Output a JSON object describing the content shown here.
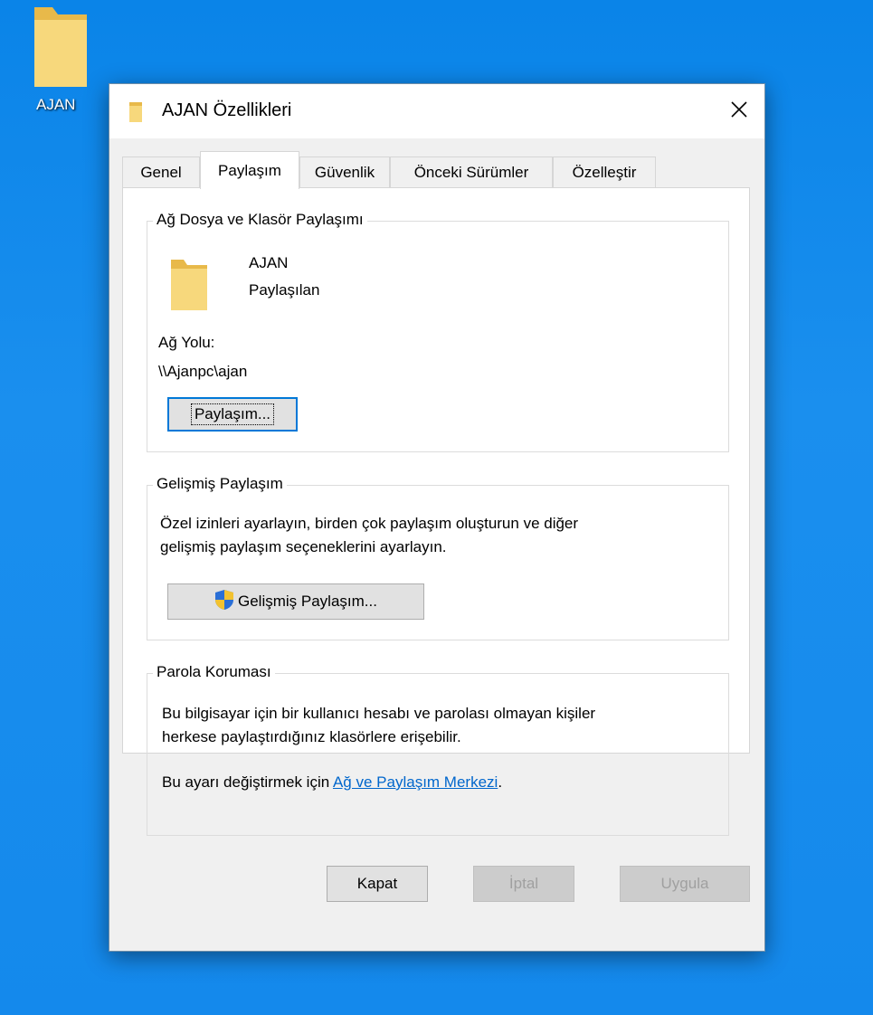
{
  "desktop": {
    "icon_label": "AJAN"
  },
  "window": {
    "title": "AJAN Özellikleri"
  },
  "tabs": [
    {
      "label": "Genel"
    },
    {
      "label": "Paylaşım"
    },
    {
      "label": "Güvenlik"
    },
    {
      "label": "Önceki Sürümler"
    },
    {
      "label": "Özelleştir"
    }
  ],
  "network_sharing": {
    "legend": "Ağ Dosya ve Klasör Paylaşımı",
    "folder_name": "AJAN",
    "status": "Paylaşılan",
    "path_label": "Ağ Yolu:",
    "path_value": "\\\\Ajanpc\\ajan",
    "share_button": "Paylaşım..."
  },
  "advanced_sharing": {
    "legend": "Gelişmiş Paylaşım",
    "description_line1": "Özel izinleri ayarlayın, birden çok paylaşım oluşturun ve diğer",
    "description_line2": "gelişmiş paylaşım seçeneklerini ayarlayın.",
    "button": "Gelişmiş Paylaşım..."
  },
  "password_protection": {
    "legend": "Parola Koruması",
    "description_line1": "Bu bilgisayar için bir kullanıcı hesabı ve parolası olmayan kişiler",
    "description_line2": "herkese paylaştırdığınız klasörlere erişebilir.",
    "change_prefix": "Bu ayarı değiştirmek için ",
    "link": "Ağ ve Paylaşım Merkezi",
    "change_suffix": "."
  },
  "footer": {
    "close": "Kapat",
    "cancel": "İptal",
    "apply": "Uygula"
  },
  "colors": {
    "desktop_bg": "#0a84e8",
    "accent": "#0078d7",
    "link": "#0066cc",
    "folder": "#f7d87c"
  }
}
